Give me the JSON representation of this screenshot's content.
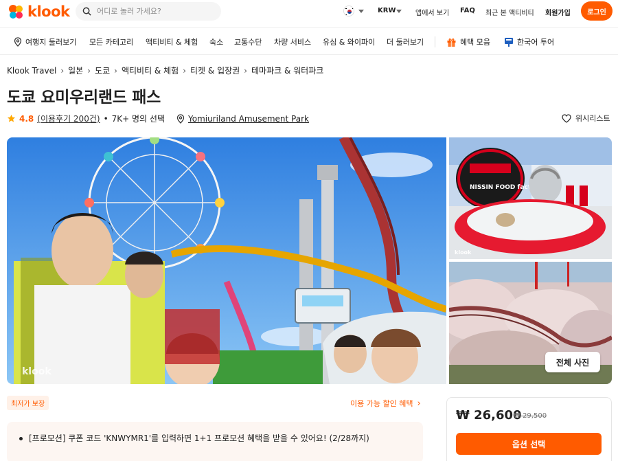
{
  "header": {
    "logo_text": "klook",
    "search_placeholder": "어디로 놀러 가세요?",
    "currency": "KRW",
    "app_link": "앱에서 보기",
    "faq": "FAQ",
    "recent": "최근 본 액티비티",
    "signup": "회원가입",
    "login": "로그인"
  },
  "nav": {
    "items": [
      "여행지 둘러보기",
      "모든 카테고리",
      "액티비티 & 체험",
      "숙소",
      "교통수단",
      "차량 서비스",
      "유심 & 와이파이",
      "더 둘러보기",
      "혜택 모음",
      "한국어 투어"
    ]
  },
  "breadcrumb": [
    "Klook Travel",
    "일본",
    "도쿄",
    "액티비티 & 체험",
    "티켓 & 입장권",
    "테마파크 & 워터파크"
  ],
  "product": {
    "title": "도쿄 요미우리랜드 패스",
    "rating": "4.8",
    "reviews": "(이용후기 200건)",
    "dot": "•",
    "chosen": "7K+ 명의 선택",
    "location": "Yomiuriland Amusement Park",
    "wishlist": "위시리스트"
  },
  "gallery": {
    "watermark": "klook",
    "all_photos": "전체 사진",
    "sign_text": "NISSIN FOOD factory"
  },
  "offers": {
    "badge": "최저가 보장",
    "discount_link": "이용 가능 할인 혜택",
    "promo": "[프로모션] 쿠폰 코드 'KNWYMR1'를 입력하면 1+1 프로모션 혜택을 받을 수 있어요! (2/28까지)"
  },
  "pricing": {
    "price": "₩ 26,600",
    "original": "₩ 29,500",
    "button": "옵션 선택"
  },
  "colors": {
    "brand": "#ff5b00"
  }
}
